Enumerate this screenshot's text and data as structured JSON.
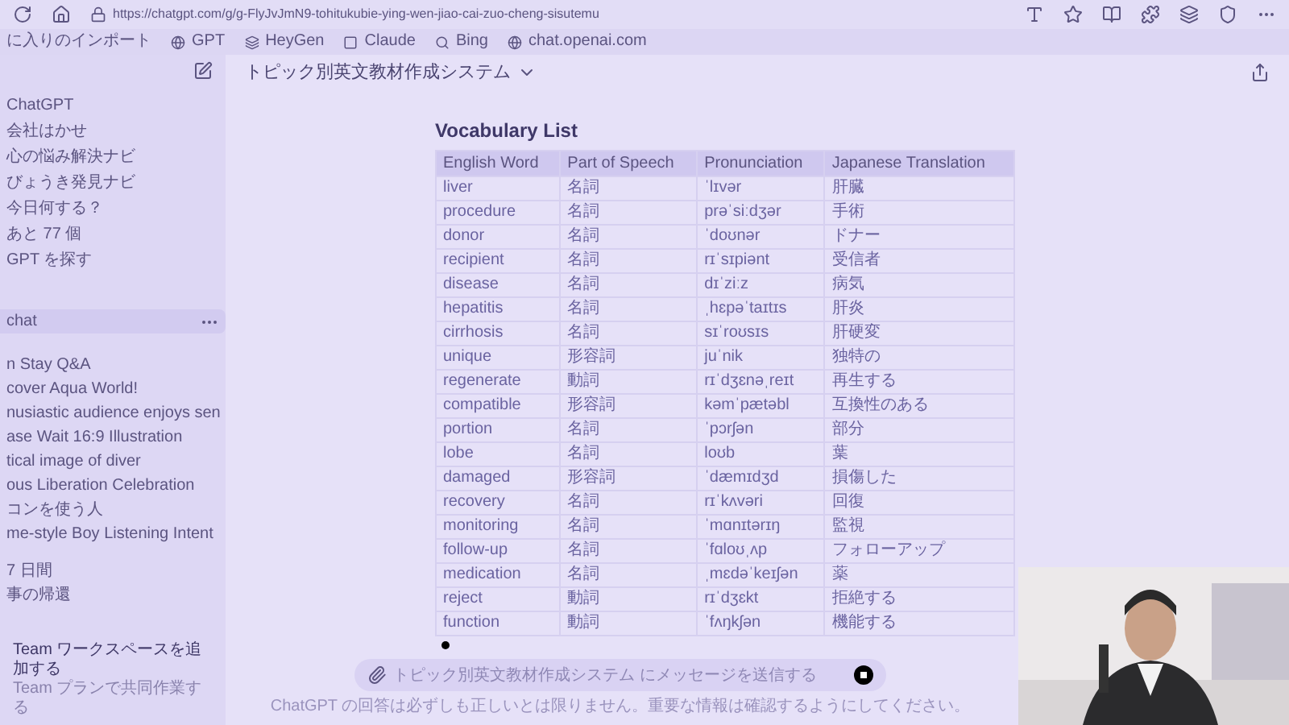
{
  "browser": {
    "url": "https://chatgpt.com/g/g-FlyJvJmN9-tohitukubie-ying-wen-jiao-cai-zuo-cheng-sisutemu",
    "bookmarks": [
      "に入りのインポート",
      "GPT",
      "HeyGen",
      "Claude",
      "Bing",
      "chat.openai.com"
    ]
  },
  "sidebar": {
    "items": [
      {
        "label": "ChatGPT",
        "selected": false
      },
      {
        "label": "会社はかせ",
        "selected": false
      },
      {
        "label": "心の悩み解決ナビ",
        "selected": false
      },
      {
        "label": "びょうき発見ナビ",
        "selected": false
      },
      {
        "label": "今日何する？",
        "selected": false
      },
      {
        "label": "あと 77 個",
        "selected": false
      },
      {
        "label": "GPT を探す",
        "selected": false
      }
    ],
    "chats": [
      {
        "label": "chat",
        "selected": true
      },
      {
        "label": "n Stay Q&A",
        "selected": false
      },
      {
        "label": "cover Aqua World!",
        "selected": false
      },
      {
        "label": "nusiastic audience enjoys sen",
        "selected": false
      },
      {
        "label": "ase Wait 16:9 Illustration",
        "selected": false
      },
      {
        "label": "tical image of diver",
        "selected": false
      },
      {
        "label": "ous Liberation Celebration",
        "selected": false
      },
      {
        "label": "コンを使う人",
        "selected": false
      },
      {
        "label": "me-style Boy Listening Intent",
        "selected": false
      }
    ],
    "section": "7 日間",
    "older": [
      "事の帰還"
    ],
    "team": {
      "title": "Team ワークスペースを追加する",
      "subtitle": "Team プランで共同作業する"
    }
  },
  "header": {
    "title": "トピック別英文教材作成システム"
  },
  "table": {
    "title": "Vocabulary List",
    "columns": [
      "English Word",
      "Part of Speech",
      "Pronunciation",
      "Japanese Translation"
    ],
    "rows": [
      [
        "liver",
        "名詞",
        "ˈlɪvər",
        "肝臓"
      ],
      [
        "procedure",
        "名詞",
        "prəˈsiːdʒər",
        "手術"
      ],
      [
        "donor",
        "名詞",
        "ˈdoʊnər",
        "ドナー"
      ],
      [
        "recipient",
        "名詞",
        "rɪˈsɪpiənt",
        "受信者"
      ],
      [
        "disease",
        "名詞",
        "dɪˈziːz",
        "病気"
      ],
      [
        "hepatitis",
        "名詞",
        "ˌhɛpəˈtaɪtɪs",
        "肝炎"
      ],
      [
        "cirrhosis",
        "名詞",
        "sɪˈroʊsɪs",
        "肝硬変"
      ],
      [
        "unique",
        "形容詞",
        "juˈnik",
        "独特の"
      ],
      [
        "regenerate",
        "動詞",
        "rɪˈdʒɛnəˌreɪt",
        "再生する"
      ],
      [
        "compatible",
        "形容詞",
        "kəmˈpætəbl",
        "互換性のある"
      ],
      [
        "portion",
        "名詞",
        "ˈpɔrʃən",
        "部分"
      ],
      [
        "lobe",
        "名詞",
        "loʊb",
        "葉"
      ],
      [
        "damaged",
        "形容詞",
        "ˈdæmɪdʒd",
        "損傷した"
      ],
      [
        "recovery",
        "名詞",
        "rɪˈkʌvəri",
        "回復"
      ],
      [
        "monitoring",
        "名詞",
        "ˈmɑnɪtərɪŋ",
        "監視"
      ],
      [
        "follow-up",
        "名詞",
        "ˈfɑloʊˌʌp",
        "フォローアップ"
      ],
      [
        "medication",
        "名詞",
        "ˌmɛdəˈkeɪʃən",
        "薬"
      ],
      [
        "reject",
        "動詞",
        "rɪˈdʒɛkt",
        "拒絶する"
      ],
      [
        "function",
        "動詞",
        "ˈfʌŋkʃən",
        "機能する"
      ]
    ]
  },
  "composer": {
    "placeholder": "トピック別英文教材作成システム にメッセージを送信する"
  },
  "disclaimer": "ChatGPT の回答は必ずしも正しいとは限りません。重要な情報は確認するようにしてください。"
}
